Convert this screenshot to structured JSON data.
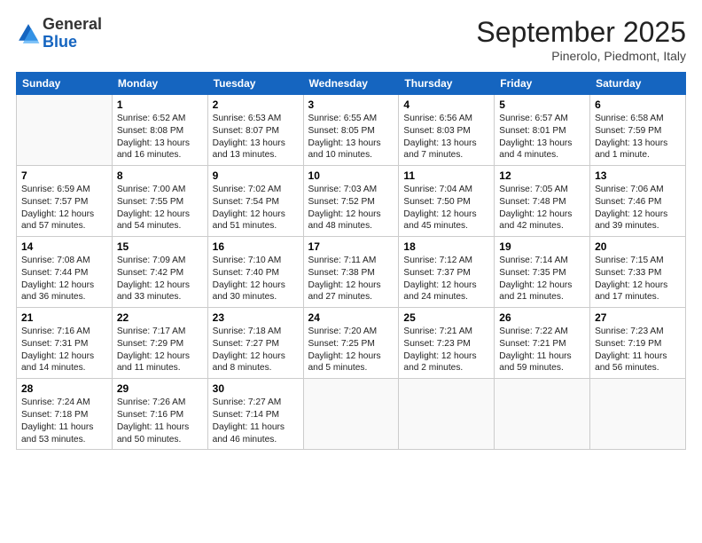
{
  "header": {
    "logo_general": "General",
    "logo_blue": "Blue",
    "month_year": "September 2025",
    "location": "Pinerolo, Piedmont, Italy"
  },
  "days_of_week": [
    "Sunday",
    "Monday",
    "Tuesday",
    "Wednesday",
    "Thursday",
    "Friday",
    "Saturday"
  ],
  "weeks": [
    [
      {
        "day": "",
        "sunrise": "",
        "sunset": "",
        "daylight": ""
      },
      {
        "day": "1",
        "sunrise": "Sunrise: 6:52 AM",
        "sunset": "Sunset: 8:08 PM",
        "daylight": "Daylight: 13 hours and 16 minutes."
      },
      {
        "day": "2",
        "sunrise": "Sunrise: 6:53 AM",
        "sunset": "Sunset: 8:07 PM",
        "daylight": "Daylight: 13 hours and 13 minutes."
      },
      {
        "day": "3",
        "sunrise": "Sunrise: 6:55 AM",
        "sunset": "Sunset: 8:05 PM",
        "daylight": "Daylight: 13 hours and 10 minutes."
      },
      {
        "day": "4",
        "sunrise": "Sunrise: 6:56 AM",
        "sunset": "Sunset: 8:03 PM",
        "daylight": "Daylight: 13 hours and 7 minutes."
      },
      {
        "day": "5",
        "sunrise": "Sunrise: 6:57 AM",
        "sunset": "Sunset: 8:01 PM",
        "daylight": "Daylight: 13 hours and 4 minutes."
      },
      {
        "day": "6",
        "sunrise": "Sunrise: 6:58 AM",
        "sunset": "Sunset: 7:59 PM",
        "daylight": "Daylight: 13 hours and 1 minute."
      }
    ],
    [
      {
        "day": "7",
        "sunrise": "Sunrise: 6:59 AM",
        "sunset": "Sunset: 7:57 PM",
        "daylight": "Daylight: 12 hours and 57 minutes."
      },
      {
        "day": "8",
        "sunrise": "Sunrise: 7:00 AM",
        "sunset": "Sunset: 7:55 PM",
        "daylight": "Daylight: 12 hours and 54 minutes."
      },
      {
        "day": "9",
        "sunrise": "Sunrise: 7:02 AM",
        "sunset": "Sunset: 7:54 PM",
        "daylight": "Daylight: 12 hours and 51 minutes."
      },
      {
        "day": "10",
        "sunrise": "Sunrise: 7:03 AM",
        "sunset": "Sunset: 7:52 PM",
        "daylight": "Daylight: 12 hours and 48 minutes."
      },
      {
        "day": "11",
        "sunrise": "Sunrise: 7:04 AM",
        "sunset": "Sunset: 7:50 PM",
        "daylight": "Daylight: 12 hours and 45 minutes."
      },
      {
        "day": "12",
        "sunrise": "Sunrise: 7:05 AM",
        "sunset": "Sunset: 7:48 PM",
        "daylight": "Daylight: 12 hours and 42 minutes."
      },
      {
        "day": "13",
        "sunrise": "Sunrise: 7:06 AM",
        "sunset": "Sunset: 7:46 PM",
        "daylight": "Daylight: 12 hours and 39 minutes."
      }
    ],
    [
      {
        "day": "14",
        "sunrise": "Sunrise: 7:08 AM",
        "sunset": "Sunset: 7:44 PM",
        "daylight": "Daylight: 12 hours and 36 minutes."
      },
      {
        "day": "15",
        "sunrise": "Sunrise: 7:09 AM",
        "sunset": "Sunset: 7:42 PM",
        "daylight": "Daylight: 12 hours and 33 minutes."
      },
      {
        "day": "16",
        "sunrise": "Sunrise: 7:10 AM",
        "sunset": "Sunset: 7:40 PM",
        "daylight": "Daylight: 12 hours and 30 minutes."
      },
      {
        "day": "17",
        "sunrise": "Sunrise: 7:11 AM",
        "sunset": "Sunset: 7:38 PM",
        "daylight": "Daylight: 12 hours and 27 minutes."
      },
      {
        "day": "18",
        "sunrise": "Sunrise: 7:12 AM",
        "sunset": "Sunset: 7:37 PM",
        "daylight": "Daylight: 12 hours and 24 minutes."
      },
      {
        "day": "19",
        "sunrise": "Sunrise: 7:14 AM",
        "sunset": "Sunset: 7:35 PM",
        "daylight": "Daylight: 12 hours and 21 minutes."
      },
      {
        "day": "20",
        "sunrise": "Sunrise: 7:15 AM",
        "sunset": "Sunset: 7:33 PM",
        "daylight": "Daylight: 12 hours and 17 minutes."
      }
    ],
    [
      {
        "day": "21",
        "sunrise": "Sunrise: 7:16 AM",
        "sunset": "Sunset: 7:31 PM",
        "daylight": "Daylight: 12 hours and 14 minutes."
      },
      {
        "day": "22",
        "sunrise": "Sunrise: 7:17 AM",
        "sunset": "Sunset: 7:29 PM",
        "daylight": "Daylight: 12 hours and 11 minutes."
      },
      {
        "day": "23",
        "sunrise": "Sunrise: 7:18 AM",
        "sunset": "Sunset: 7:27 PM",
        "daylight": "Daylight: 12 hours and 8 minutes."
      },
      {
        "day": "24",
        "sunrise": "Sunrise: 7:20 AM",
        "sunset": "Sunset: 7:25 PM",
        "daylight": "Daylight: 12 hours and 5 minutes."
      },
      {
        "day": "25",
        "sunrise": "Sunrise: 7:21 AM",
        "sunset": "Sunset: 7:23 PM",
        "daylight": "Daylight: 12 hours and 2 minutes."
      },
      {
        "day": "26",
        "sunrise": "Sunrise: 7:22 AM",
        "sunset": "Sunset: 7:21 PM",
        "daylight": "Daylight: 11 hours and 59 minutes."
      },
      {
        "day": "27",
        "sunrise": "Sunrise: 7:23 AM",
        "sunset": "Sunset: 7:19 PM",
        "daylight": "Daylight: 11 hours and 56 minutes."
      }
    ],
    [
      {
        "day": "28",
        "sunrise": "Sunrise: 7:24 AM",
        "sunset": "Sunset: 7:18 PM",
        "daylight": "Daylight: 11 hours and 53 minutes."
      },
      {
        "day": "29",
        "sunrise": "Sunrise: 7:26 AM",
        "sunset": "Sunset: 7:16 PM",
        "daylight": "Daylight: 11 hours and 50 minutes."
      },
      {
        "day": "30",
        "sunrise": "Sunrise: 7:27 AM",
        "sunset": "Sunset: 7:14 PM",
        "daylight": "Daylight: 11 hours and 46 minutes."
      },
      {
        "day": "",
        "sunrise": "",
        "sunset": "",
        "daylight": ""
      },
      {
        "day": "",
        "sunrise": "",
        "sunset": "",
        "daylight": ""
      },
      {
        "day": "",
        "sunrise": "",
        "sunset": "",
        "daylight": ""
      },
      {
        "day": "",
        "sunrise": "",
        "sunset": "",
        "daylight": ""
      }
    ]
  ]
}
